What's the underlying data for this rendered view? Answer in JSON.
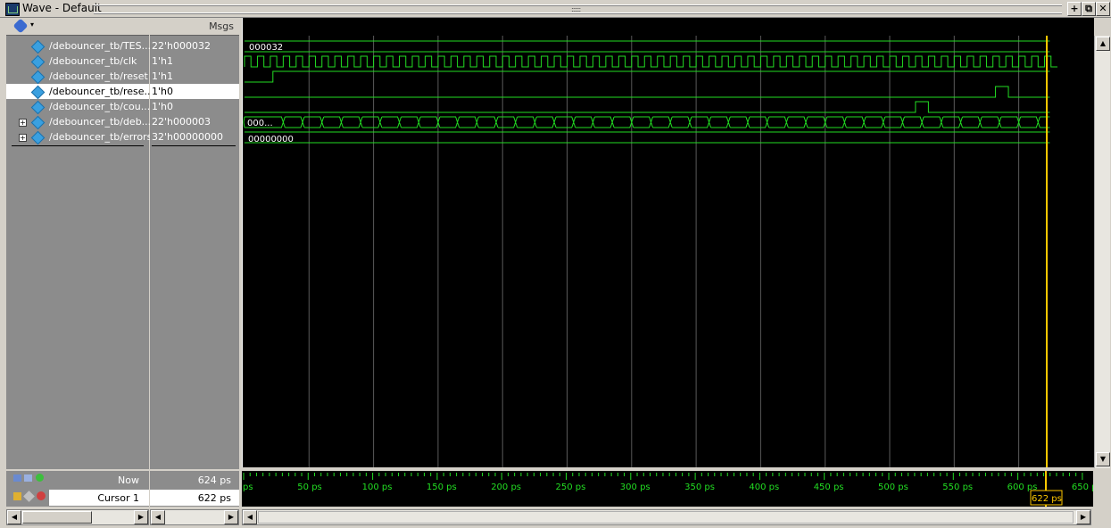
{
  "window": {
    "title": "Wave - Default",
    "grip": "::::::",
    "buttons": [
      "+",
      "⧉",
      "✕"
    ]
  },
  "header": {
    "values_label": "Msgs"
  },
  "signals": [
    {
      "name": "/debouncer_tb/TES...",
      "value": "22'h000032",
      "expandable": false,
      "selected": false
    },
    {
      "name": "/debouncer_tb/clk",
      "value": "1'h1",
      "expandable": false,
      "selected": false
    },
    {
      "name": "/debouncer_tb/reset",
      "value": "1'h1",
      "expandable": false,
      "selected": false
    },
    {
      "name": "/debouncer_tb/rese...",
      "value": "1'h0",
      "expandable": false,
      "selected": true
    },
    {
      "name": "/debouncer_tb/cou...",
      "value": "1'h0",
      "expandable": false,
      "selected": false
    },
    {
      "name": "/debouncer_tb/deb...",
      "value": "22'h000003",
      "expandable": true,
      "selected": false
    },
    {
      "name": "/debouncer_tb/errors",
      "value": "32'h00000000",
      "expandable": true,
      "selected": false
    }
  ],
  "wave_labels": {
    "tes": "000032",
    "deb": "000...",
    "errors": "00000000"
  },
  "status": {
    "now_label": "Now",
    "now_value": "624 ps",
    "cursor_label": "Cursor 1",
    "cursor_value": "622 ps",
    "cursor_time": "622 ps"
  },
  "timeline": {
    "labels": [
      "ps",
      "50 ps",
      "100 ps",
      "150 ps",
      "200 ps",
      "250 ps",
      "300 ps",
      "350 ps",
      "400 ps",
      "450 ps",
      "500 ps",
      "550 ps",
      "600 ps",
      "650 p"
    ]
  },
  "colors": {
    "wave": "#22dd22",
    "cursor": "#ffc800",
    "grid": "#5a5a5a",
    "timeline_text": "#22dd22"
  }
}
